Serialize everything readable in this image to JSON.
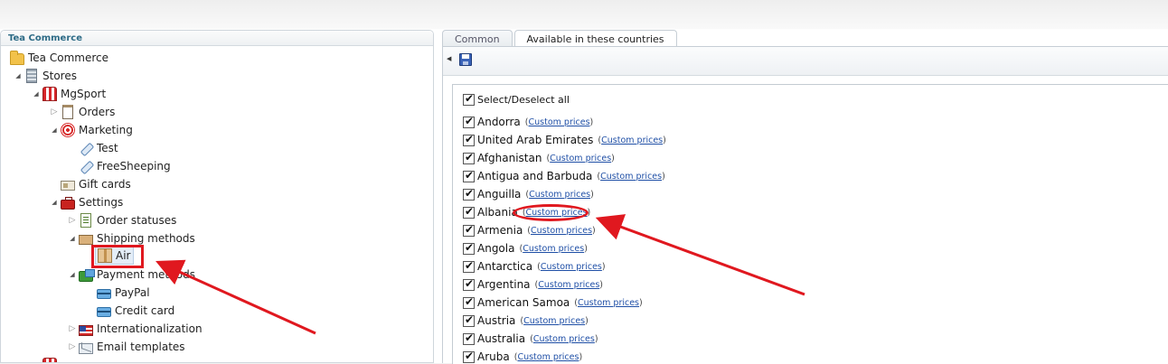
{
  "left_panel": {
    "header": "Tea Commerce",
    "tree": [
      {
        "label": "Tea Commerce",
        "icon": "folder-icon"
      },
      {
        "label": "Stores",
        "icon": "building-icon"
      },
      {
        "label": "MgSport",
        "icon": "store-icon"
      },
      {
        "label": "Orders",
        "icon": "clipboard-icon"
      },
      {
        "label": "Marketing",
        "icon": "target-icon"
      },
      {
        "label": "Test",
        "icon": "tag-icon"
      },
      {
        "label": "FreeSheeping",
        "icon": "tag-icon"
      },
      {
        "label": "Gift cards",
        "icon": "gift-card-icon"
      },
      {
        "label": "Settings",
        "icon": "toolbox-icon"
      },
      {
        "label": "Order statuses",
        "icon": "checklist-icon"
      },
      {
        "label": "Shipping methods",
        "icon": "truck-icon"
      },
      {
        "label": "Air",
        "icon": "box-icon"
      },
      {
        "label": "Payment methods",
        "icon": "wallet-icon"
      },
      {
        "label": "PayPal",
        "icon": "credit-card-icon"
      },
      {
        "label": "Credit card",
        "icon": "credit-card-icon"
      },
      {
        "label": "Internationalization",
        "icon": "flag-icon"
      },
      {
        "label": "Email templates",
        "icon": "email-icon"
      }
    ]
  },
  "tabs": [
    {
      "label": "Common",
      "active": false
    },
    {
      "label": "Available in these countries",
      "active": true
    }
  ],
  "countries": {
    "select_all_label": "Select/Deselect all",
    "custom_prices_label": "Custom prices",
    "items": [
      "Andorra",
      "United Arab Emirates",
      "Afghanistan",
      "Antigua and Barbuda",
      "Anguilla",
      "Albania",
      "Armenia",
      "Angola",
      "Antarctica",
      "Argentina",
      "American Samoa",
      "Austria",
      "Australia",
      "Aruba"
    ]
  },
  "colors": {
    "highlight": "#e0181f",
    "link": "#1f4fa6",
    "header_text": "#2d6b86"
  }
}
